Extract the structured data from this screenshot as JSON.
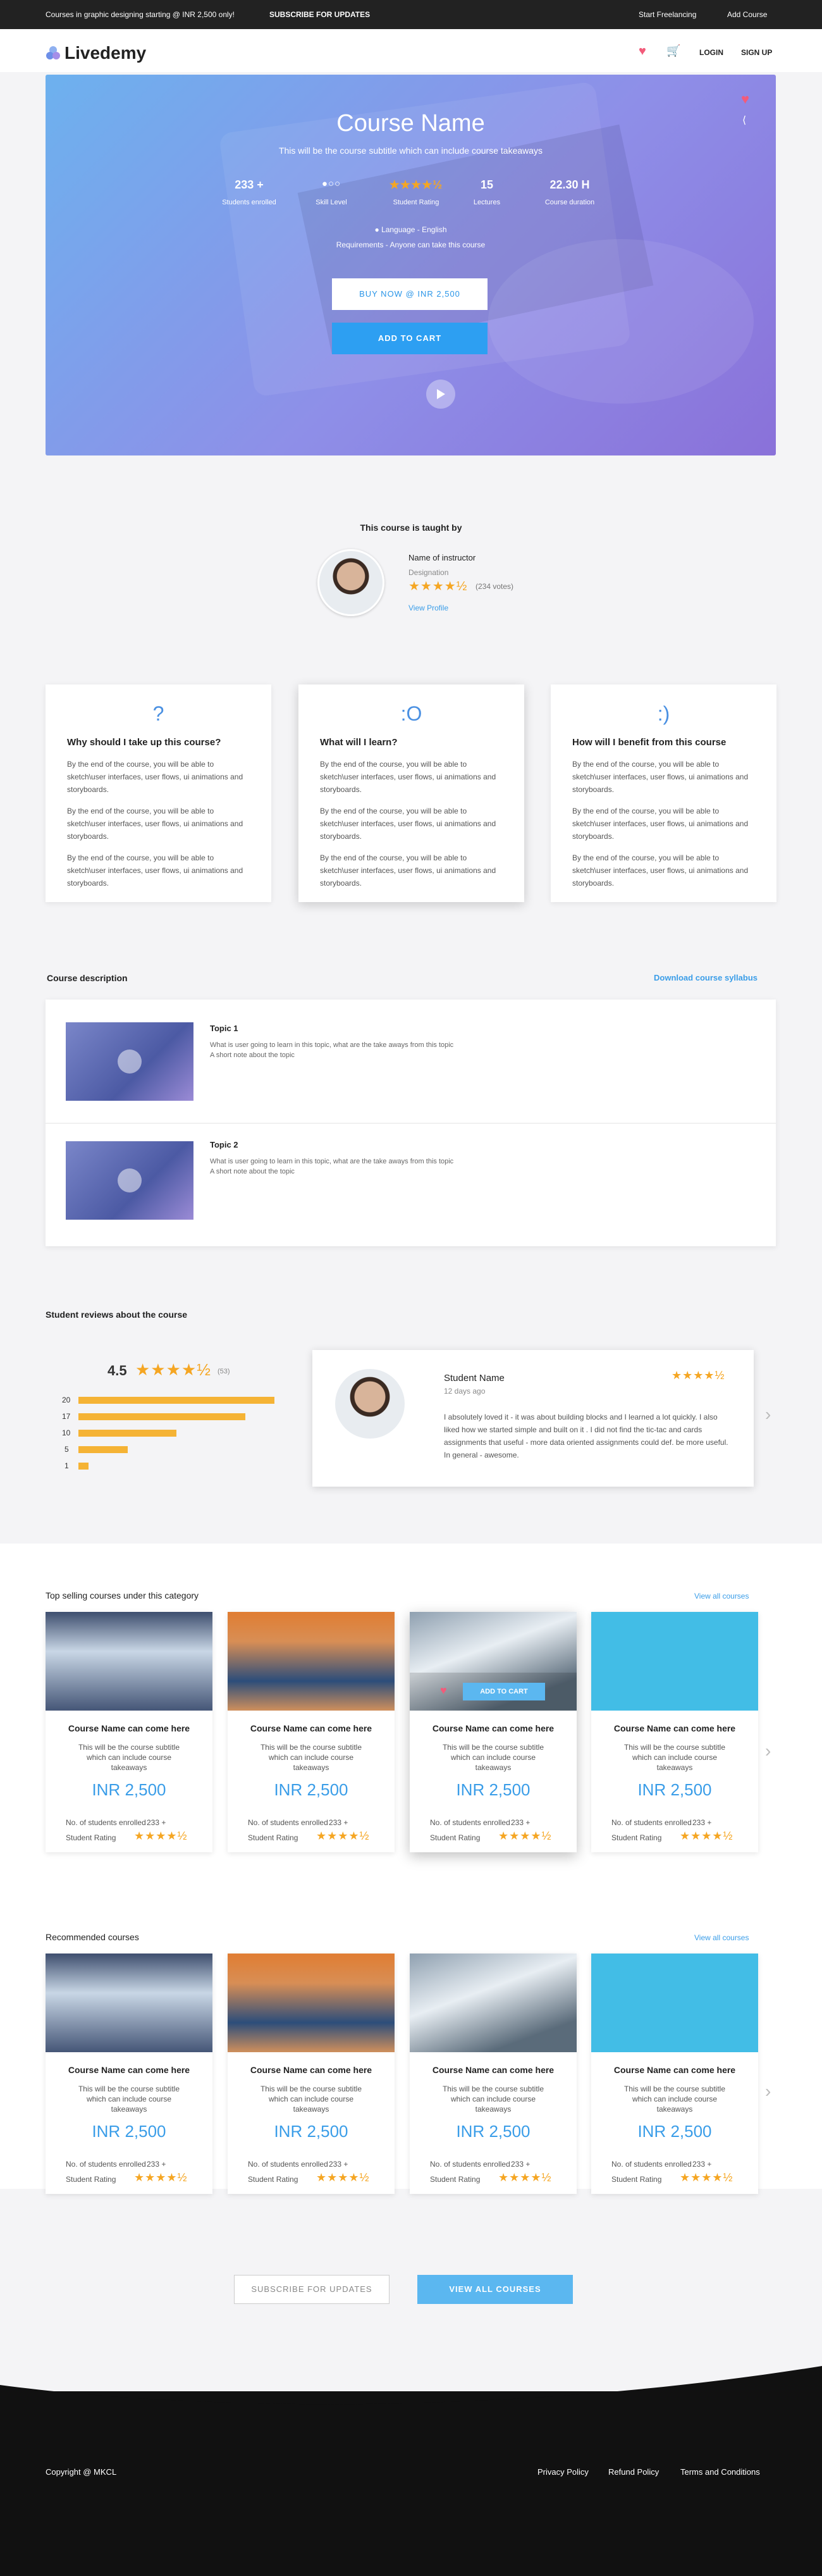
{
  "topbar": {
    "promo": "Courses in graphic designing starting @ INR 2,500 only!",
    "subscribe": "SUBSCRIBE FOR UPDATES",
    "freelancing": "Start Freelancing",
    "add_course": "Add Course"
  },
  "header": {
    "logo": "Livedemy",
    "login": "LOGIN",
    "signup": "SIGN UP"
  },
  "hero": {
    "title": "Course Name",
    "subtitle": "This will be the course subtitle which can include course takeaways",
    "stats": [
      {
        "value": "233 +",
        "label": "Students enrolled"
      },
      {
        "value": "",
        "label": "Skill Level"
      },
      {
        "value": "",
        "label": "Student Rating"
      },
      {
        "value": "15",
        "label": "Lectures"
      },
      {
        "value": "22.30 H",
        "label": "Course duration"
      }
    ],
    "language": "Language - English",
    "requirements": "Requirements - Anyone can take this course",
    "buy_label": "BUY NOW @ INR 2,500",
    "cart_label": "ADD TO CART",
    "rating_stars": 4.5,
    "skill_level": 1
  },
  "instructor": {
    "heading": "This course is taught by",
    "name": "Name of instructor",
    "designation": "Designation",
    "votes": "(234 votes)",
    "view_profile": "View Profile",
    "rating_stars": 4.5
  },
  "features": [
    {
      "icon": "?",
      "title": "Why should I take up this course?",
      "paras": [
        "By the end of the course, you will be able to sketch\\user interfaces, user flows, ui animations and storyboards.",
        "By the end of the course, you will be able to sketch\\user interfaces, user flows, ui animations and storyboards.",
        "By the end of the course, you will be able to sketch\\user interfaces, user flows, ui animations and storyboards."
      ]
    },
    {
      "icon": ":O",
      "title": "What will I learn?",
      "paras": [
        "By the end of the course, you will be able to sketch\\user interfaces, user flows, ui animations and storyboards.",
        "By the end of the course, you will be able to sketch\\user interfaces, user flows, ui animations and storyboards.",
        "By the end of the course, you will be able to sketch\\user interfaces, user flows, ui animations and storyboards."
      ]
    },
    {
      "icon": ":)",
      "title": "How will I benefit from this course",
      "paras": [
        "By the end of the course, you will be able to sketch\\user interfaces, user flows, ui animations and storyboards.",
        "By the end of the course, you will be able to sketch\\user interfaces, user flows, ui animations and storyboards.",
        "By the end of the course, you will be able to sketch\\user interfaces, user flows, ui animations and storyboards."
      ]
    }
  ],
  "description": {
    "heading": "Course description",
    "download": "Download course syllabus",
    "topics": [
      {
        "title": "Topic 1",
        "line1": "What is user going to learn in this topic, what are the take aways from this topic",
        "line2": "A short note about the topic"
      },
      {
        "title": "Topic 2",
        "line1": "What is user going to learn in this topic, what are the take aways from this topic",
        "line2": "A short note about the topic"
      }
    ]
  },
  "reviews": {
    "heading": "Student reviews about the course",
    "average": "4.5",
    "count": "(53)",
    "average_stars": 4.5,
    "bars": [
      {
        "label": "20",
        "value": 20
      },
      {
        "label": "17",
        "value": 17
      },
      {
        "label": "10",
        "value": 10
      },
      {
        "label": "5",
        "value": 5
      },
      {
        "label": "1",
        "value": 1
      }
    ],
    "review": {
      "name": "Student Name",
      "time": "12 days ago",
      "text": "I absolutely loved it - it was about building blocks and I learned a lot quickly. I also liked how we started simple and built on it . I did not find the tic-tac and cards assignments that useful - more data oriented assignments could def. be more useful. In general - awesome.",
      "stars": 4.5
    }
  },
  "top_selling": {
    "heading": "Top selling courses under this category",
    "view_all": "View all courses",
    "add_to_cart": "ADD TO CART",
    "cards": [
      {
        "title": "Course Name can come here",
        "subtitle": "This will be the course subtitle which can include course takeaways",
        "price": "INR 2,500",
        "enrolled_label": "No. of students enrolled",
        "enrolled": "233 +",
        "rating_label": "Student Rating",
        "stars": 4.5
      },
      {
        "title": "Course Name can come here",
        "subtitle": "This will be the course subtitle which can include course takeaways",
        "price": "INR 2,500",
        "enrolled_label": "No. of students enrolled",
        "enrolled": "233 +",
        "rating_label": "Student Rating",
        "stars": 4.5
      },
      {
        "title": "Course Name can come here",
        "subtitle": "This will be the course subtitle which can include course takeaways",
        "price": "INR 2,500",
        "enrolled_label": "No. of students enrolled",
        "enrolled": "233 +",
        "rating_label": "Student Rating",
        "stars": 4.5
      },
      {
        "title": "Course Name can come here",
        "subtitle": "This will be the course subtitle which can include course takeaways",
        "price": "INR 2,500",
        "enrolled_label": "No. of students enrolled",
        "enrolled": "233 +",
        "rating_label": "Student Rating",
        "stars": 4.5
      }
    ]
  },
  "recommended": {
    "heading": "Recommended courses",
    "view_all": "View all courses",
    "cards": [
      {
        "title": "Course Name can come here",
        "subtitle": "This will be the course subtitle which can include course takeaways",
        "price": "INR 2,500",
        "enrolled_label": "No. of students enrolled",
        "enrolled": "233 +",
        "rating_label": "Student Rating",
        "stars": 4.5
      },
      {
        "title": "Course Name can come here",
        "subtitle": "This will be the course subtitle which can include course takeaways",
        "price": "INR 2,500",
        "enrolled_label": "No. of students enrolled",
        "enrolled": "233 +",
        "rating_label": "Student Rating",
        "stars": 4.5
      },
      {
        "title": "Course Name can come here",
        "subtitle": "This will be the course subtitle which can include course takeaways",
        "price": "INR 2,500",
        "enrolled_label": "No. of students enrolled",
        "enrolled": "233 +",
        "rating_label": "Student Rating",
        "stars": 4.5
      },
      {
        "title": "Course Name can come here",
        "subtitle": "This will be the course subtitle which can include course takeaways",
        "price": "INR 2,500",
        "enrolled_label": "No. of students enrolled",
        "enrolled": "233 +",
        "rating_label": "Student Rating",
        "stars": 4.5
      }
    ]
  },
  "cta": {
    "subscribe": "SUBSCRIBE FOR UPDATES",
    "view_all": "VIEW ALL COURSES"
  },
  "footer": {
    "copyright": "Copyright @ MKCL",
    "privacy": "Privacy Policy",
    "refund": "Refund Policy",
    "terms": "Terms and Conditions"
  },
  "colors": {
    "accent": "#2d9ff2",
    "star": "#f5a623",
    "heart": "#f25b7a",
    "cart": "#3cc14d"
  }
}
